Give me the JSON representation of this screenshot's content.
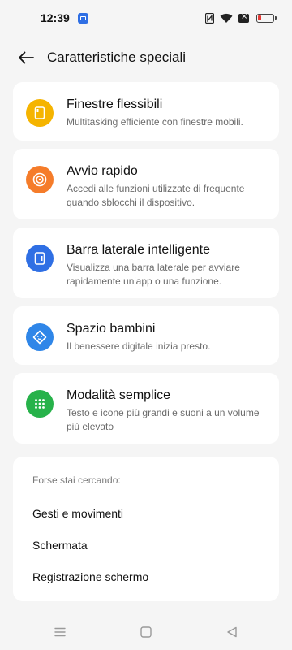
{
  "status": {
    "time": "12:39"
  },
  "header": {
    "title": "Caratteristiche speciali"
  },
  "features": [
    {
      "title": "Finestre flessibili",
      "description": "Multitasking efficiente con finestre mobili.",
      "icon": "flexible-window-icon",
      "color": "#f5b400"
    },
    {
      "title": "Avvio rapido",
      "description": "Accedi alle funzioni utilizzate di frequente quando sblocchi il dispositivo.",
      "icon": "quick-launch-icon",
      "color": "#f57c2a"
    },
    {
      "title": "Barra laterale intelligente",
      "description": "Visualizza una barra laterale per avviare rapidamente un'app o una funzione.",
      "icon": "smart-sidebar-icon",
      "color": "#2f6fe4"
    },
    {
      "title": "Spazio bambini",
      "description": "Il benessere digitale inizia presto.",
      "icon": "kids-space-icon",
      "color": "#2f86e8"
    },
    {
      "title": "Modalità semplice",
      "description": "Testo e icone più grandi e suoni a un volume più elevato",
      "icon": "simple-mode-icon",
      "color": "#27b24a"
    }
  ],
  "suggestions": {
    "header": "Forse stai cercando:",
    "items": [
      "Gesti e movimenti",
      "Schermata",
      "Registrazione schermo"
    ]
  }
}
